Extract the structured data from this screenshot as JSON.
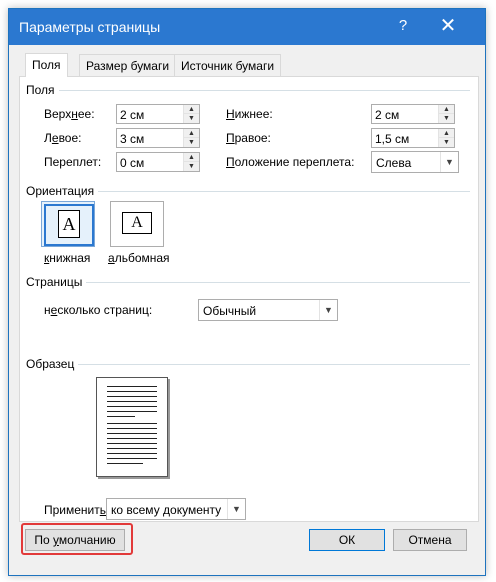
{
  "window": {
    "title": "Параметры страницы",
    "help_glyph": "?",
    "close_glyph": "✕"
  },
  "tabs": [
    {
      "label": "Поля",
      "active": true
    },
    {
      "label": "Размер бумаги",
      "active": false
    },
    {
      "label": "Источник бумаги",
      "active": false
    }
  ],
  "margins": {
    "group_label": "Поля",
    "top": {
      "label_a": "Верх",
      "label_u": "н",
      "label_b": "ее:",
      "value": "2 см"
    },
    "bottom": {
      "label_a": "",
      "label_u": "Н",
      "label_b": "ижнее:",
      "value": "2 см"
    },
    "left": {
      "label_a": "Л",
      "label_u": "е",
      "label_b": "вое:",
      "value": "3 см"
    },
    "right": {
      "label_a": "",
      "label_u": "П",
      "label_b": "равое:",
      "value": "1,5 см"
    },
    "gutter": {
      "label_a": "Переплет:",
      "label_u": "",
      "label_b": "",
      "value": "0 см"
    },
    "gutter_pos": {
      "label_a": "",
      "label_u": "П",
      "label_b": "оложение переплета:",
      "value": "Слева"
    }
  },
  "orientation": {
    "group_label": "Ориентация",
    "portrait": {
      "label_u": "к",
      "label_b": "нижная",
      "glyph": "A",
      "selected": true
    },
    "landscape": {
      "label_u": "а",
      "label_b": "льбомная",
      "glyph": "A",
      "selected": false
    }
  },
  "pages": {
    "group_label": "Страницы",
    "multiple_label_a": "н",
    "multiple_label_u": "е",
    "multiple_label_b": "сколько страниц:",
    "value": "Обычный"
  },
  "preview": {
    "group_label": "Образец"
  },
  "apply": {
    "label_a": "Применит",
    "label_u": "ь",
    "label_b": ":",
    "value": "ко всему документу"
  },
  "buttons": {
    "default_label_a": "По ",
    "default_label_u": "у",
    "default_label_b": "молчанию",
    "ok_label": "ОК",
    "cancel_label": "Отмена"
  },
  "colors": {
    "titlebar": "#2b78d0",
    "highlight": "#e23a3a",
    "selection": "#2b78d0"
  },
  "icons": {
    "spin_up": "▲",
    "spin_down": "▼",
    "dropdown": "▼"
  }
}
